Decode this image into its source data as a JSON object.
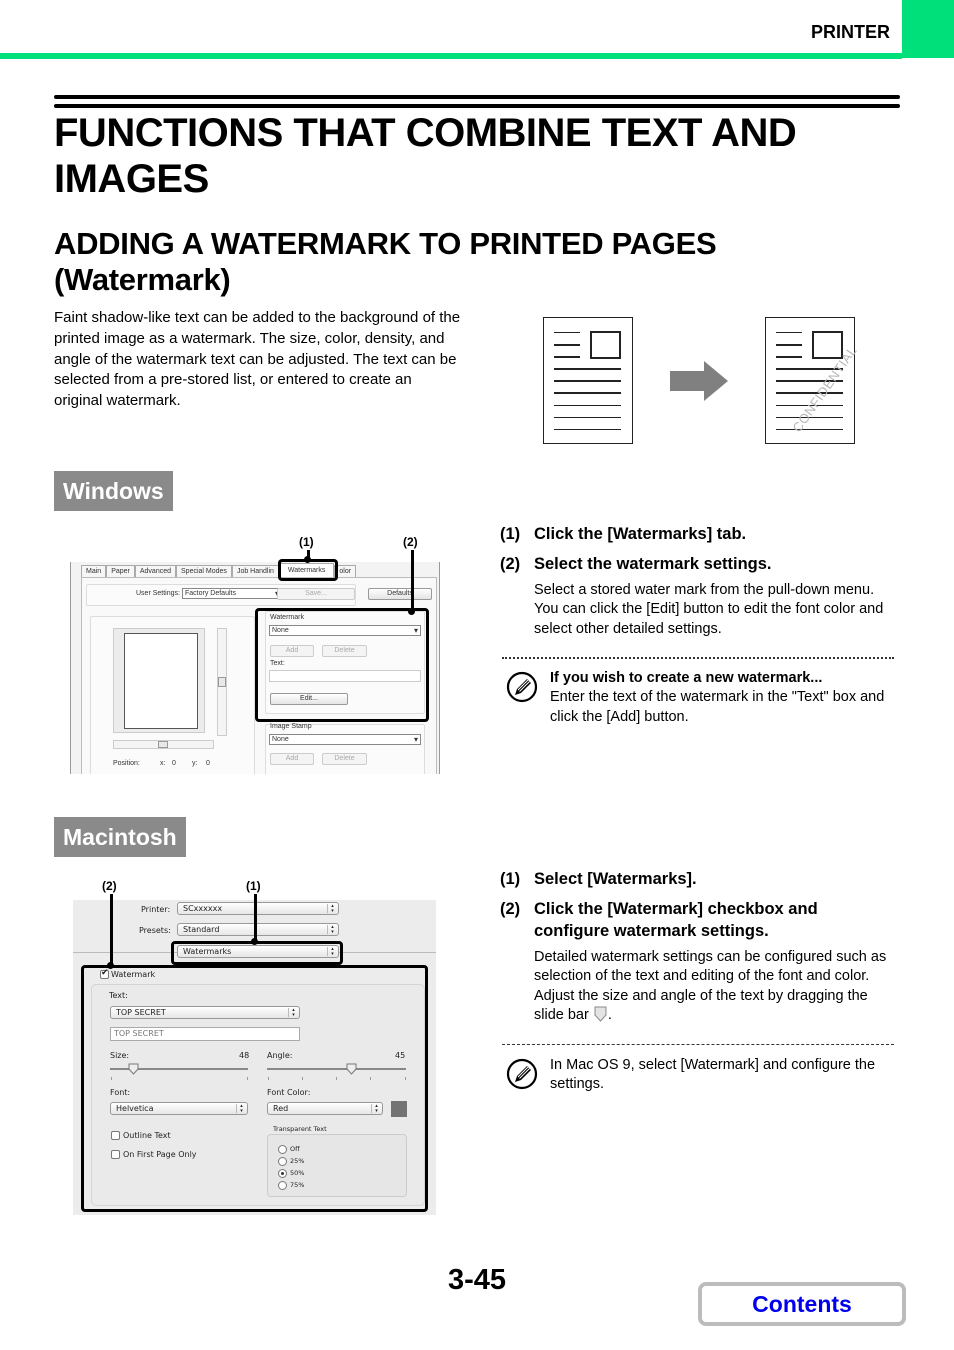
{
  "header": {
    "section": "PRINTER",
    "accent_color": "#00e07a"
  },
  "title": "FUNCTIONS THAT COMBINE TEXT AND IMAGES",
  "subtitle": "ADDING A WATERMARK TO PRINTED PAGES (Watermark)",
  "intro": "Faint shadow-like text can be added to the background of the printed image as a watermark. The size, color, density, and angle of the watermark text can be adjusted. The text can be selected from a pre-stored list, or entered to create an original watermark.",
  "illustration": {
    "watermark_text": "CONFIDENTIAL",
    "icon": "arrow-right-icon"
  },
  "windows": {
    "tag": "Windows",
    "callouts": [
      "(1)",
      "(2)"
    ],
    "steps": [
      {
        "num": "(1)",
        "text": "Click the [Watermarks] tab."
      },
      {
        "num": "(2)",
        "text": "Select the watermark settings."
      }
    ],
    "step2_desc": "Select a stored water mark from the pull-down menu. You can click the [Edit] button to edit the font color and select other detailed settings.",
    "note": {
      "title": "If you wish to create a new watermark...",
      "body": "Enter the text of the watermark in the \"Text\" box and click the [Add] button."
    },
    "dialog": {
      "tabs": [
        "Main",
        "Paper",
        "Advanced",
        "Special Modes",
        "Job Handlin",
        "Watermarks",
        "olor"
      ],
      "user_settings_label": "User Settings:",
      "user_settings_value": "Factory Defaults",
      "save_label": "Save...",
      "defaults_label": "Defaults",
      "watermark_label": "Watermark",
      "watermark_value": "None",
      "add_label": "Add",
      "delete_label": "Delete",
      "text_label": "Text:",
      "text_value": "",
      "edit_label": "Edit...",
      "image_stamp_label": "Image Stamp",
      "image_stamp_value": "None",
      "position_label": "Position:",
      "x_label": "x:",
      "x_value": "0",
      "y_label": "y:",
      "y_value": "0"
    }
  },
  "mac": {
    "tag": "Macintosh",
    "callouts": [
      "(2)",
      "(1)"
    ],
    "steps": [
      {
        "num": "(1)",
        "text": "Select [Watermarks]."
      },
      {
        "num": "(2)",
        "text": "Click the [Watermark] checkbox and configure watermark settings."
      }
    ],
    "step2_desc": "Detailed watermark settings can be configured such as selection of the text and editing of the font and color. Adjust the size and angle of the text by dragging the slide bar",
    "step2_desc_end": ".",
    "note": {
      "body": "In Mac OS 9, select [Watermark] and configure the settings."
    },
    "dialog": {
      "printer_label": "Printer:",
      "printer_value": "SCxxxxxx",
      "presets_label": "Presets:",
      "presets_value": "Standard",
      "panel_value": "Watermarks",
      "watermark_checkbox_label": "Watermark",
      "watermark_checked": true,
      "text_label": "Text:",
      "text_select": "TOP SECRET",
      "text_field": "TOP SECRET",
      "size_label": "Size:",
      "size_value": "48",
      "angle_label": "Angle:",
      "angle_value": "45",
      "font_label": "Font:",
      "font_value": "Helvetica",
      "font_color_label": "Font Color:",
      "font_color_value": "Red",
      "outline_label": "Outline Text",
      "first_page_label": "On First Page Only",
      "transparent_label": "Transparent Text",
      "transparent_options": [
        "Off",
        "25%",
        "50%",
        "75%"
      ],
      "transparent_selected": "50%"
    }
  },
  "footer": {
    "page_number": "3-45",
    "contents_label": "Contents",
    "contents_color": "#0000ee"
  }
}
